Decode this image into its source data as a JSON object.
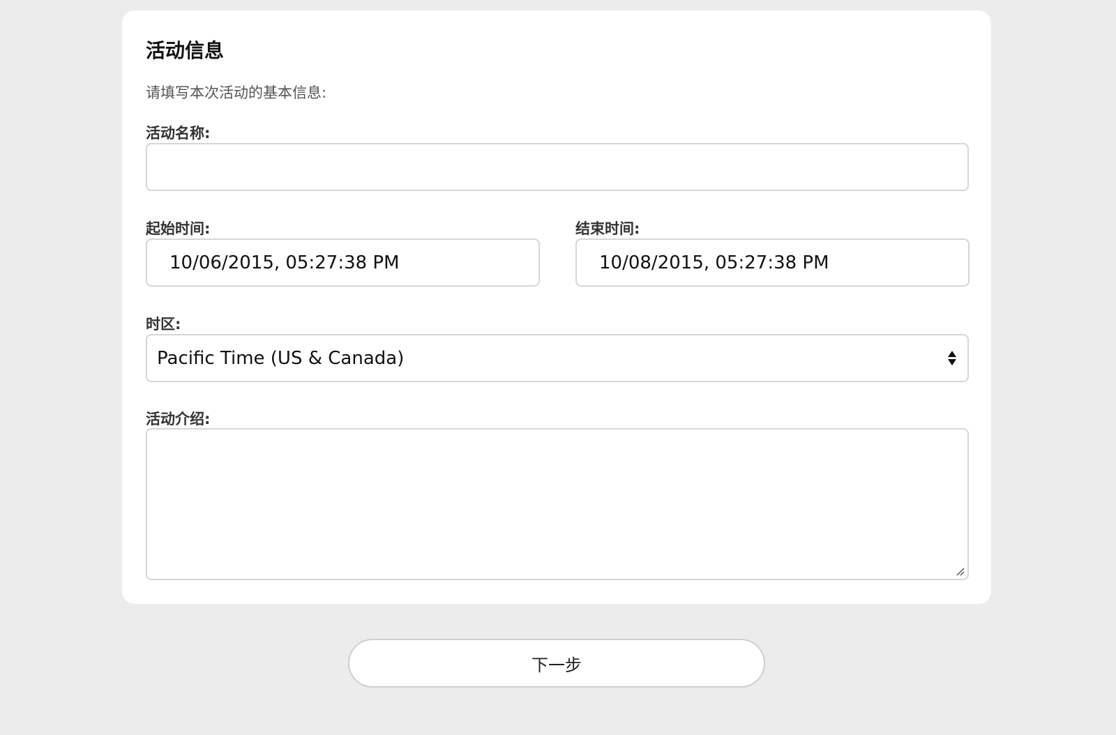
{
  "form": {
    "title": "活动信息",
    "intro": "请填写本次活动的基本信息:",
    "name_label": "活动名称:",
    "name_value": "",
    "start_label": "起始时间:",
    "start_value": "10/06/2015, 05:27:38 PM",
    "end_label": "结束时间:",
    "end_value": "10/08/2015, 05:27:38 PM",
    "timezone_label": "时区:",
    "timezone_value": "Pacific Time (US & Canada)",
    "description_label": "活动介绍:",
    "description_value": ""
  },
  "actions": {
    "next_label": "下一步"
  },
  "icons": {
    "select": "select-arrows-icon",
    "resize": "resize-grip-icon"
  },
  "colors": {
    "background": "#ececec",
    "card": "#ffffff",
    "border": "#d6d6d6"
  }
}
